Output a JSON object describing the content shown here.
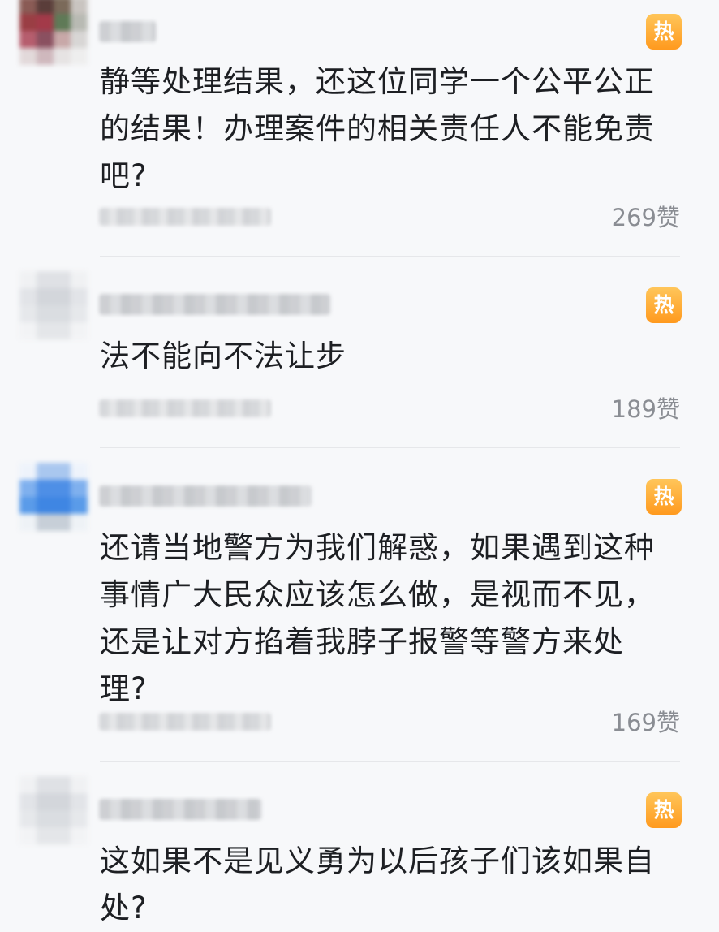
{
  "hot_label": "热",
  "comments": [
    {
      "text": "静等处理结果，还这位同学一个公平公正的结果！办理案件的相关责任人不能免责吧?",
      "likes": "269赞"
    },
    {
      "text": "法不能向不法让步",
      "likes": "189赞"
    },
    {
      "text": "还请当地警方为我们解惑，如果遇到这种事情广大民众应该怎么做，是视而不见，还是让对方掐着我脖子报警等警方来处理?",
      "likes": "169赞"
    },
    {
      "text": "这如果不是见义勇为以后孩子们该如果自处?",
      "likes": ""
    }
  ],
  "colors": {
    "hot_badge": "#ff9a1e",
    "text": "#1d1f23",
    "likes": "#8a8d93",
    "background": "#f7f8fa"
  }
}
